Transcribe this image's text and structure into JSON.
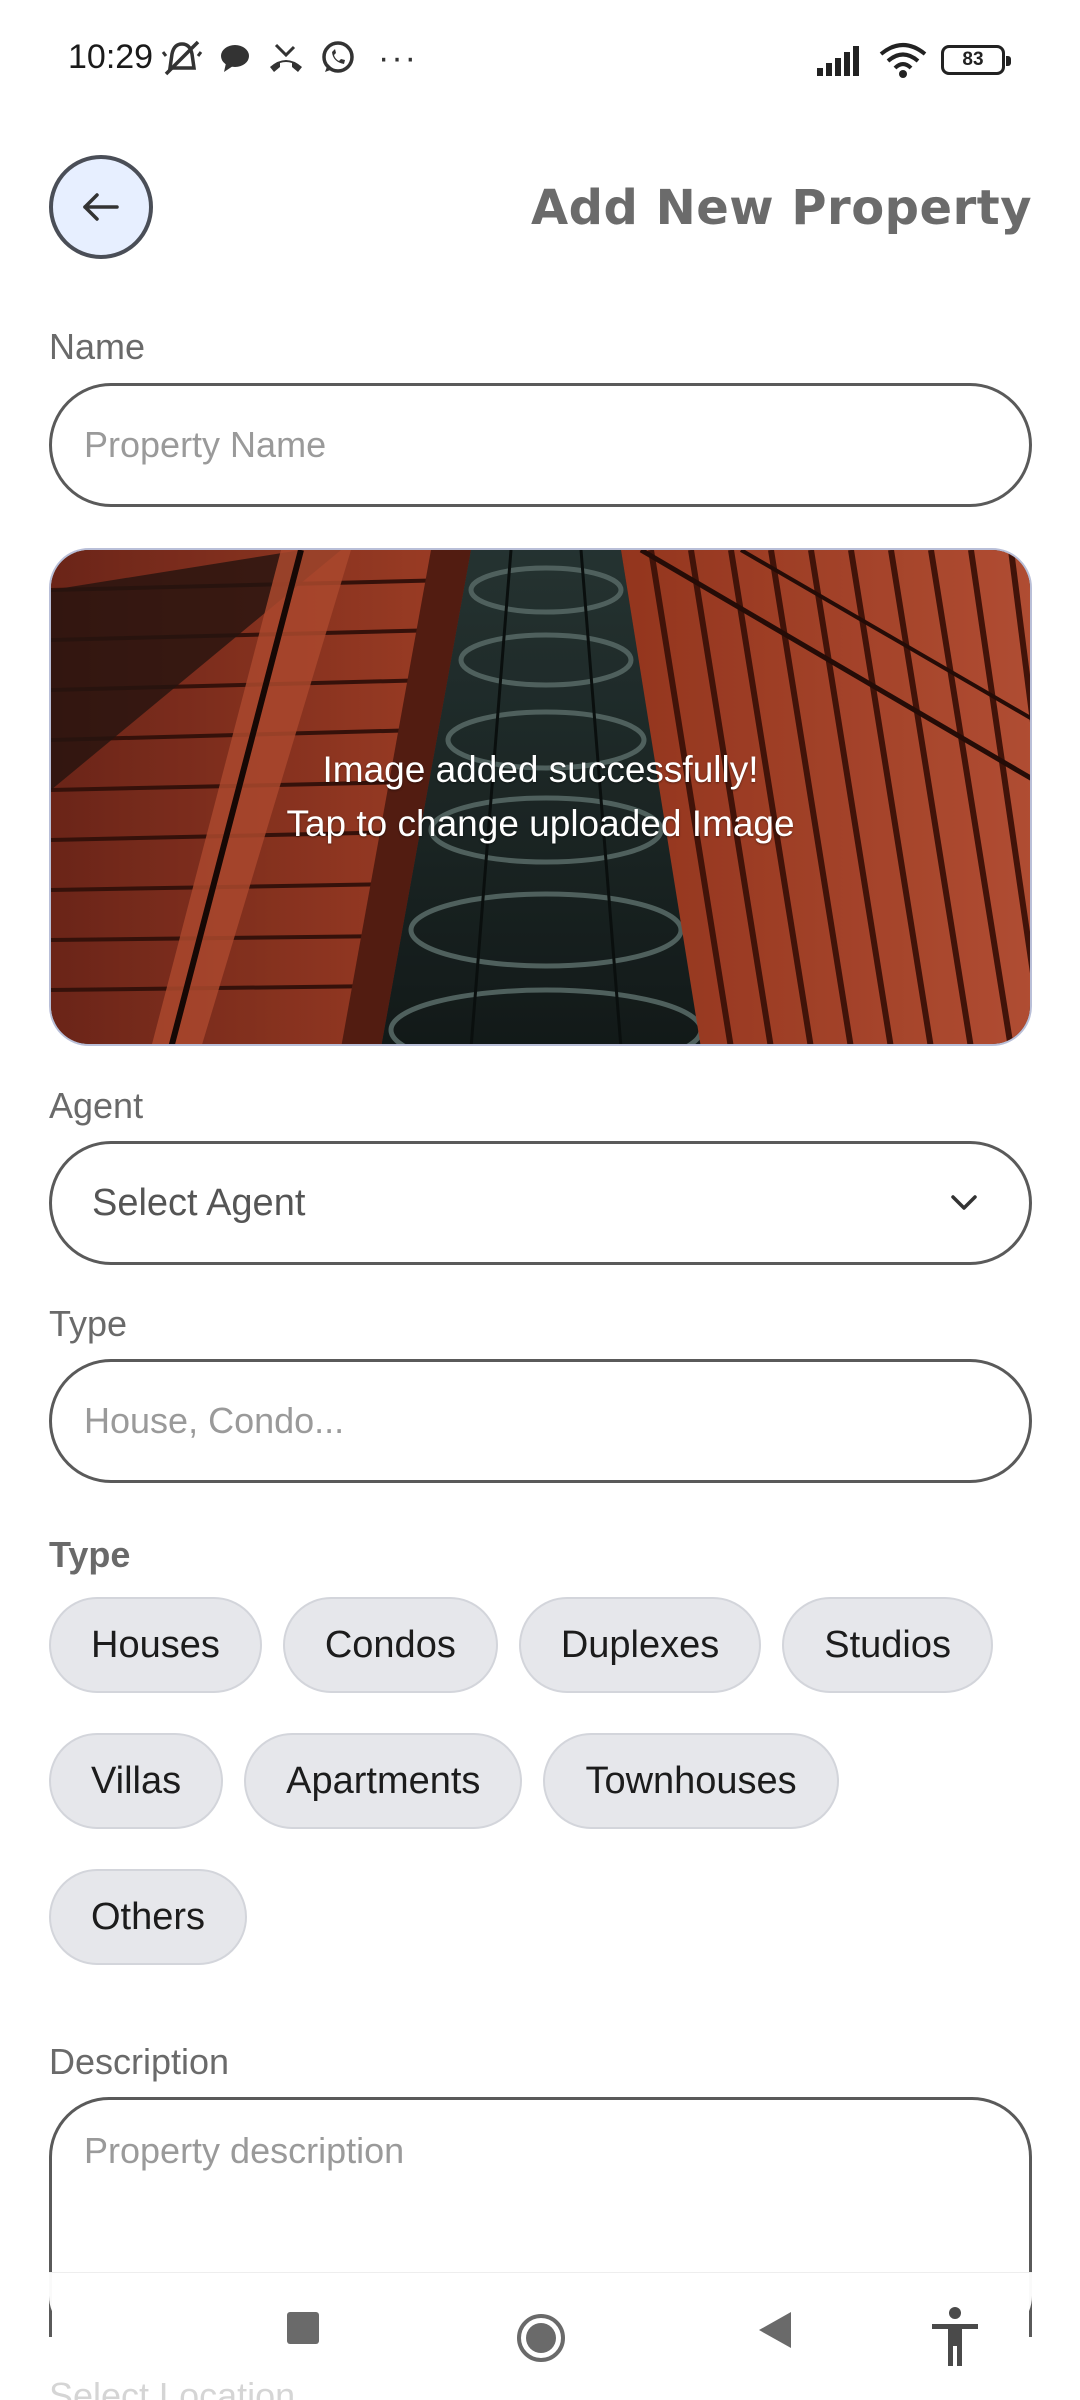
{
  "status_bar": {
    "time": "10:29",
    "battery": "83",
    "more": "···"
  },
  "header": {
    "title": "Add New Property",
    "back_icon": "arrow-left-icon"
  },
  "form": {
    "name_label": "Name",
    "name_placeholder": "Property Name",
    "image_status_line1": "Image added successfully!",
    "image_status_line2": "Tap to change uploaded Image",
    "agent_label": "Agent",
    "agent_value": "Select Agent",
    "type_label": "Type",
    "type_placeholder": "House, Condo...",
    "type_chips_label": "Type",
    "type_chips": [
      "Houses",
      "Condos",
      "Duplexes",
      "Studios",
      "Villas",
      "Apartments",
      "Townhouses",
      "Others"
    ],
    "description_label": "Description",
    "description_placeholder": "Property description",
    "location_label": "Select Location"
  },
  "colors": {
    "back_button_bg": "#e7efff",
    "chip_bg": "#e6e7eb",
    "title": "#6b6b6b"
  }
}
